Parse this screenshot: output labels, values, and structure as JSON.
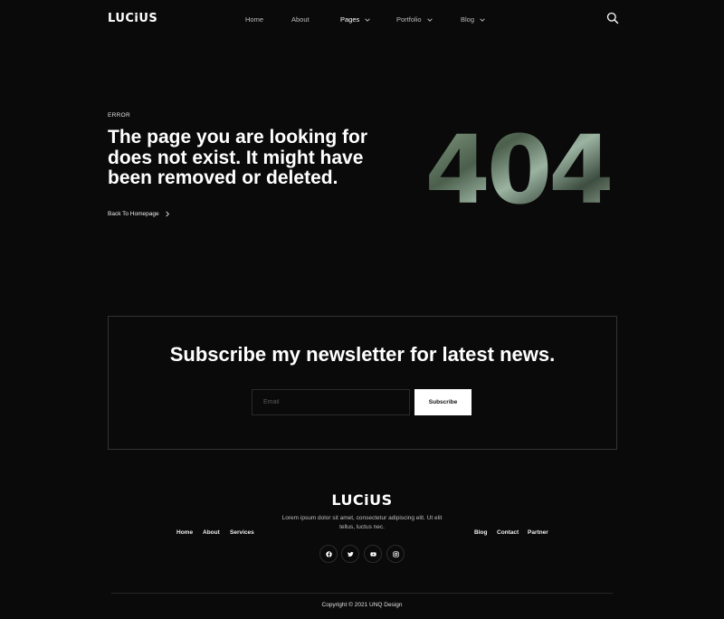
{
  "header": {
    "logo": "LUCiUS",
    "nav": [
      {
        "label": "Home",
        "has_dropdown": false,
        "active": false
      },
      {
        "label": "About",
        "has_dropdown": false,
        "active": false
      },
      {
        "label": "Pages",
        "has_dropdown": true,
        "active": true
      },
      {
        "label": "Portfolio",
        "has_dropdown": true,
        "active": false
      },
      {
        "label": "Blog",
        "has_dropdown": true,
        "active": false
      }
    ],
    "search_icon": "search-icon"
  },
  "hero": {
    "label": "ERROR",
    "headline": "The page you are looking for does not exist. It might have been removed or deleted.",
    "back_link": "Back To Homepage",
    "code": "404"
  },
  "newsletter": {
    "title": "Subscribe my newsletter for latest news.",
    "email_placeholder": "Email",
    "email_value": "",
    "button": "Subscribe"
  },
  "footer": {
    "logo": "LUCiUS",
    "description": "Lorem ipsum dolor sit amet, consectetur adipiscing elit. Ut elit tellus, luctus nec.",
    "links_left": [
      "Home",
      "About",
      "Services"
    ],
    "links_right": [
      "Blog",
      "Contact",
      "Partner"
    ],
    "social": [
      "facebook-icon",
      "twitter-icon",
      "youtube-icon",
      "instagram-icon"
    ],
    "copyright": "Copyright © 2021 UNQ Design"
  },
  "colors": {
    "background": "#0a0a0a",
    "text": "#ffffff",
    "muted": "#bdbdbd",
    "border": "#333333"
  }
}
